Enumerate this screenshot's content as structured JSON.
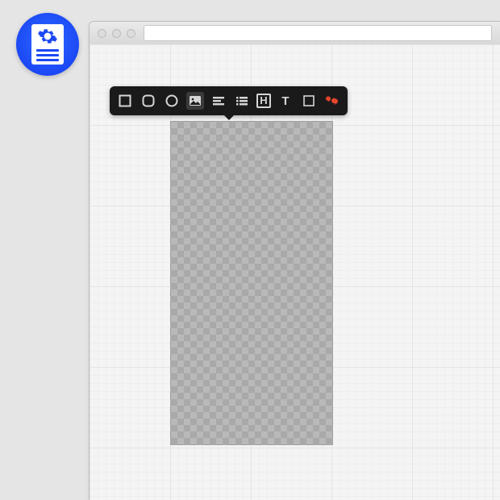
{
  "app_icon": {
    "name": "page-builder-app-icon"
  },
  "window": {
    "url_value": ""
  },
  "toolbar": {
    "items": [
      {
        "name": "square-shape-icon"
      },
      {
        "name": "rounded-square-shape-icon"
      },
      {
        "name": "circle-shape-icon"
      },
      {
        "name": "image-icon"
      },
      {
        "name": "align-left-icon"
      },
      {
        "name": "list-icon"
      },
      {
        "name": "heading-icon",
        "label": "H"
      },
      {
        "name": "text-icon",
        "label": "T"
      },
      {
        "name": "container-icon"
      },
      {
        "name": "comment-icon"
      }
    ]
  },
  "artboard": {}
}
